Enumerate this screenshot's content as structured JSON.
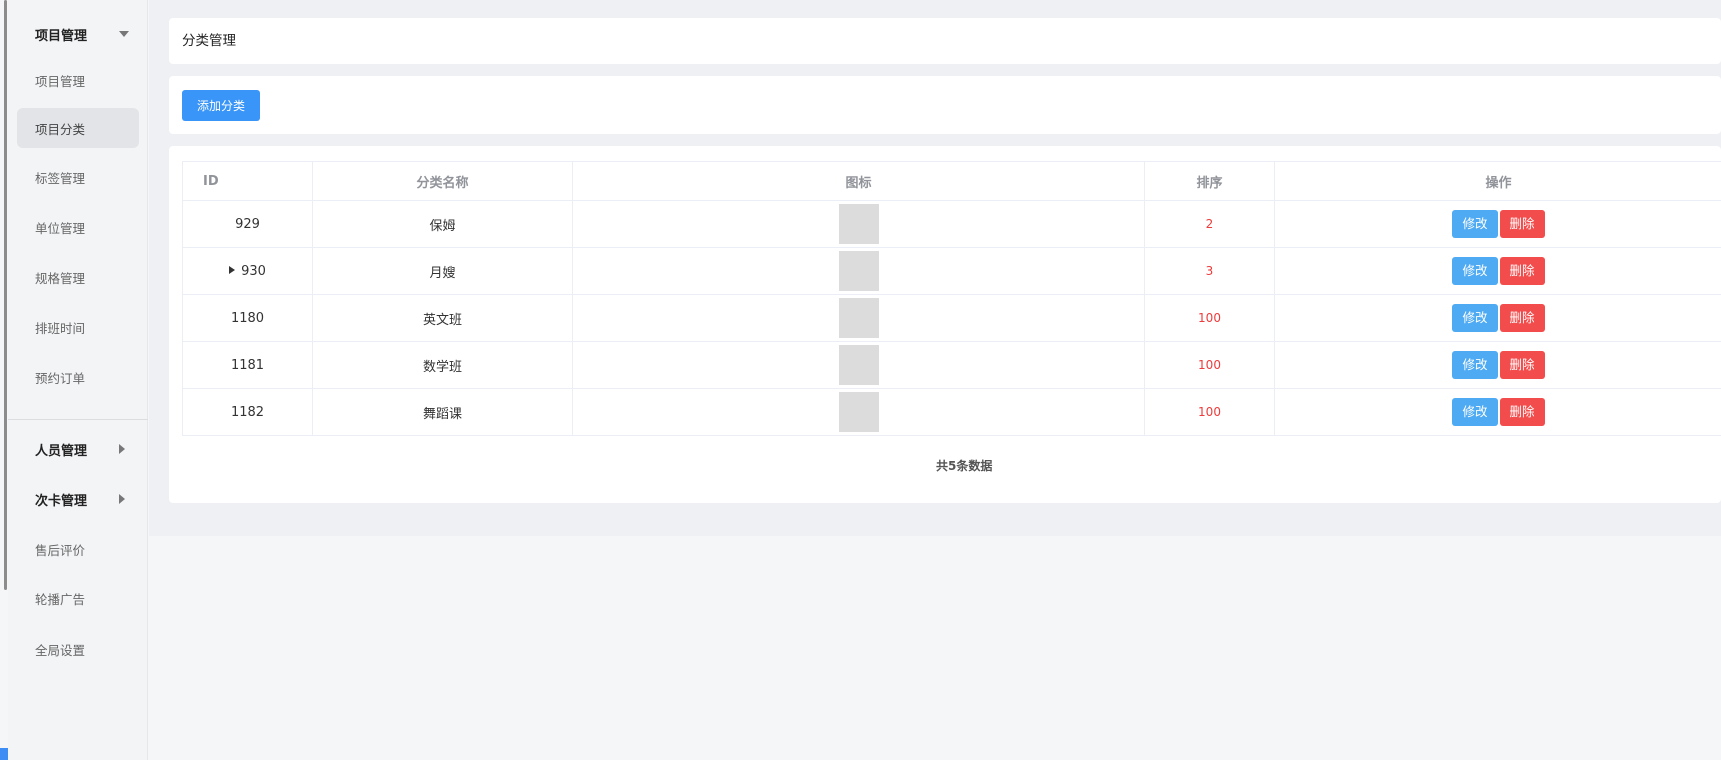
{
  "sidebar": {
    "groups": [
      {
        "label": "项目管理",
        "expanded": true
      },
      {
        "label": "人员管理",
        "expanded": false
      },
      {
        "label": "次卡管理",
        "expanded": false
      }
    ],
    "items": [
      {
        "label": "项目管理"
      },
      {
        "label": "项目分类",
        "active": true
      },
      {
        "label": "标签管理"
      },
      {
        "label": "单位管理"
      },
      {
        "label": "规格管理"
      },
      {
        "label": "排班时间"
      },
      {
        "label": "预约订单"
      },
      {
        "label": "售后评价"
      },
      {
        "label": "轮播广告"
      },
      {
        "label": "全局设置"
      }
    ]
  },
  "main": {
    "page_title": "分类管理",
    "add_button_label": "添加分类",
    "table": {
      "headers": [
        "ID",
        "分类名称",
        "图标",
        "排序",
        "操作"
      ],
      "rows": [
        {
          "id": "929",
          "name": "保姆",
          "sort": "2",
          "expandable": false
        },
        {
          "id": "930",
          "name": "月嫂",
          "sort": "3",
          "expandable": true
        },
        {
          "id": "1180",
          "name": "英文班",
          "sort": "100",
          "expandable": false
        },
        {
          "id": "1181",
          "name": "数学班",
          "sort": "100",
          "expandable": false
        },
        {
          "id": "1182",
          "name": "舞蹈课",
          "sort": "100",
          "expandable": false
        }
      ],
      "edit_label": "修改",
      "delete_label": "删除"
    },
    "summary": "共5条数据"
  },
  "colors": {
    "primary": "#3a95f8",
    "edit": "#4eaaf3",
    "danger": "#f24c4c",
    "sort_text": "#ee3b3b"
  },
  "icons": {
    "expanded_group": "caret-down-icon",
    "collapsed_group": "caret-right-icon",
    "expand_row": "caret-right-icon"
  }
}
